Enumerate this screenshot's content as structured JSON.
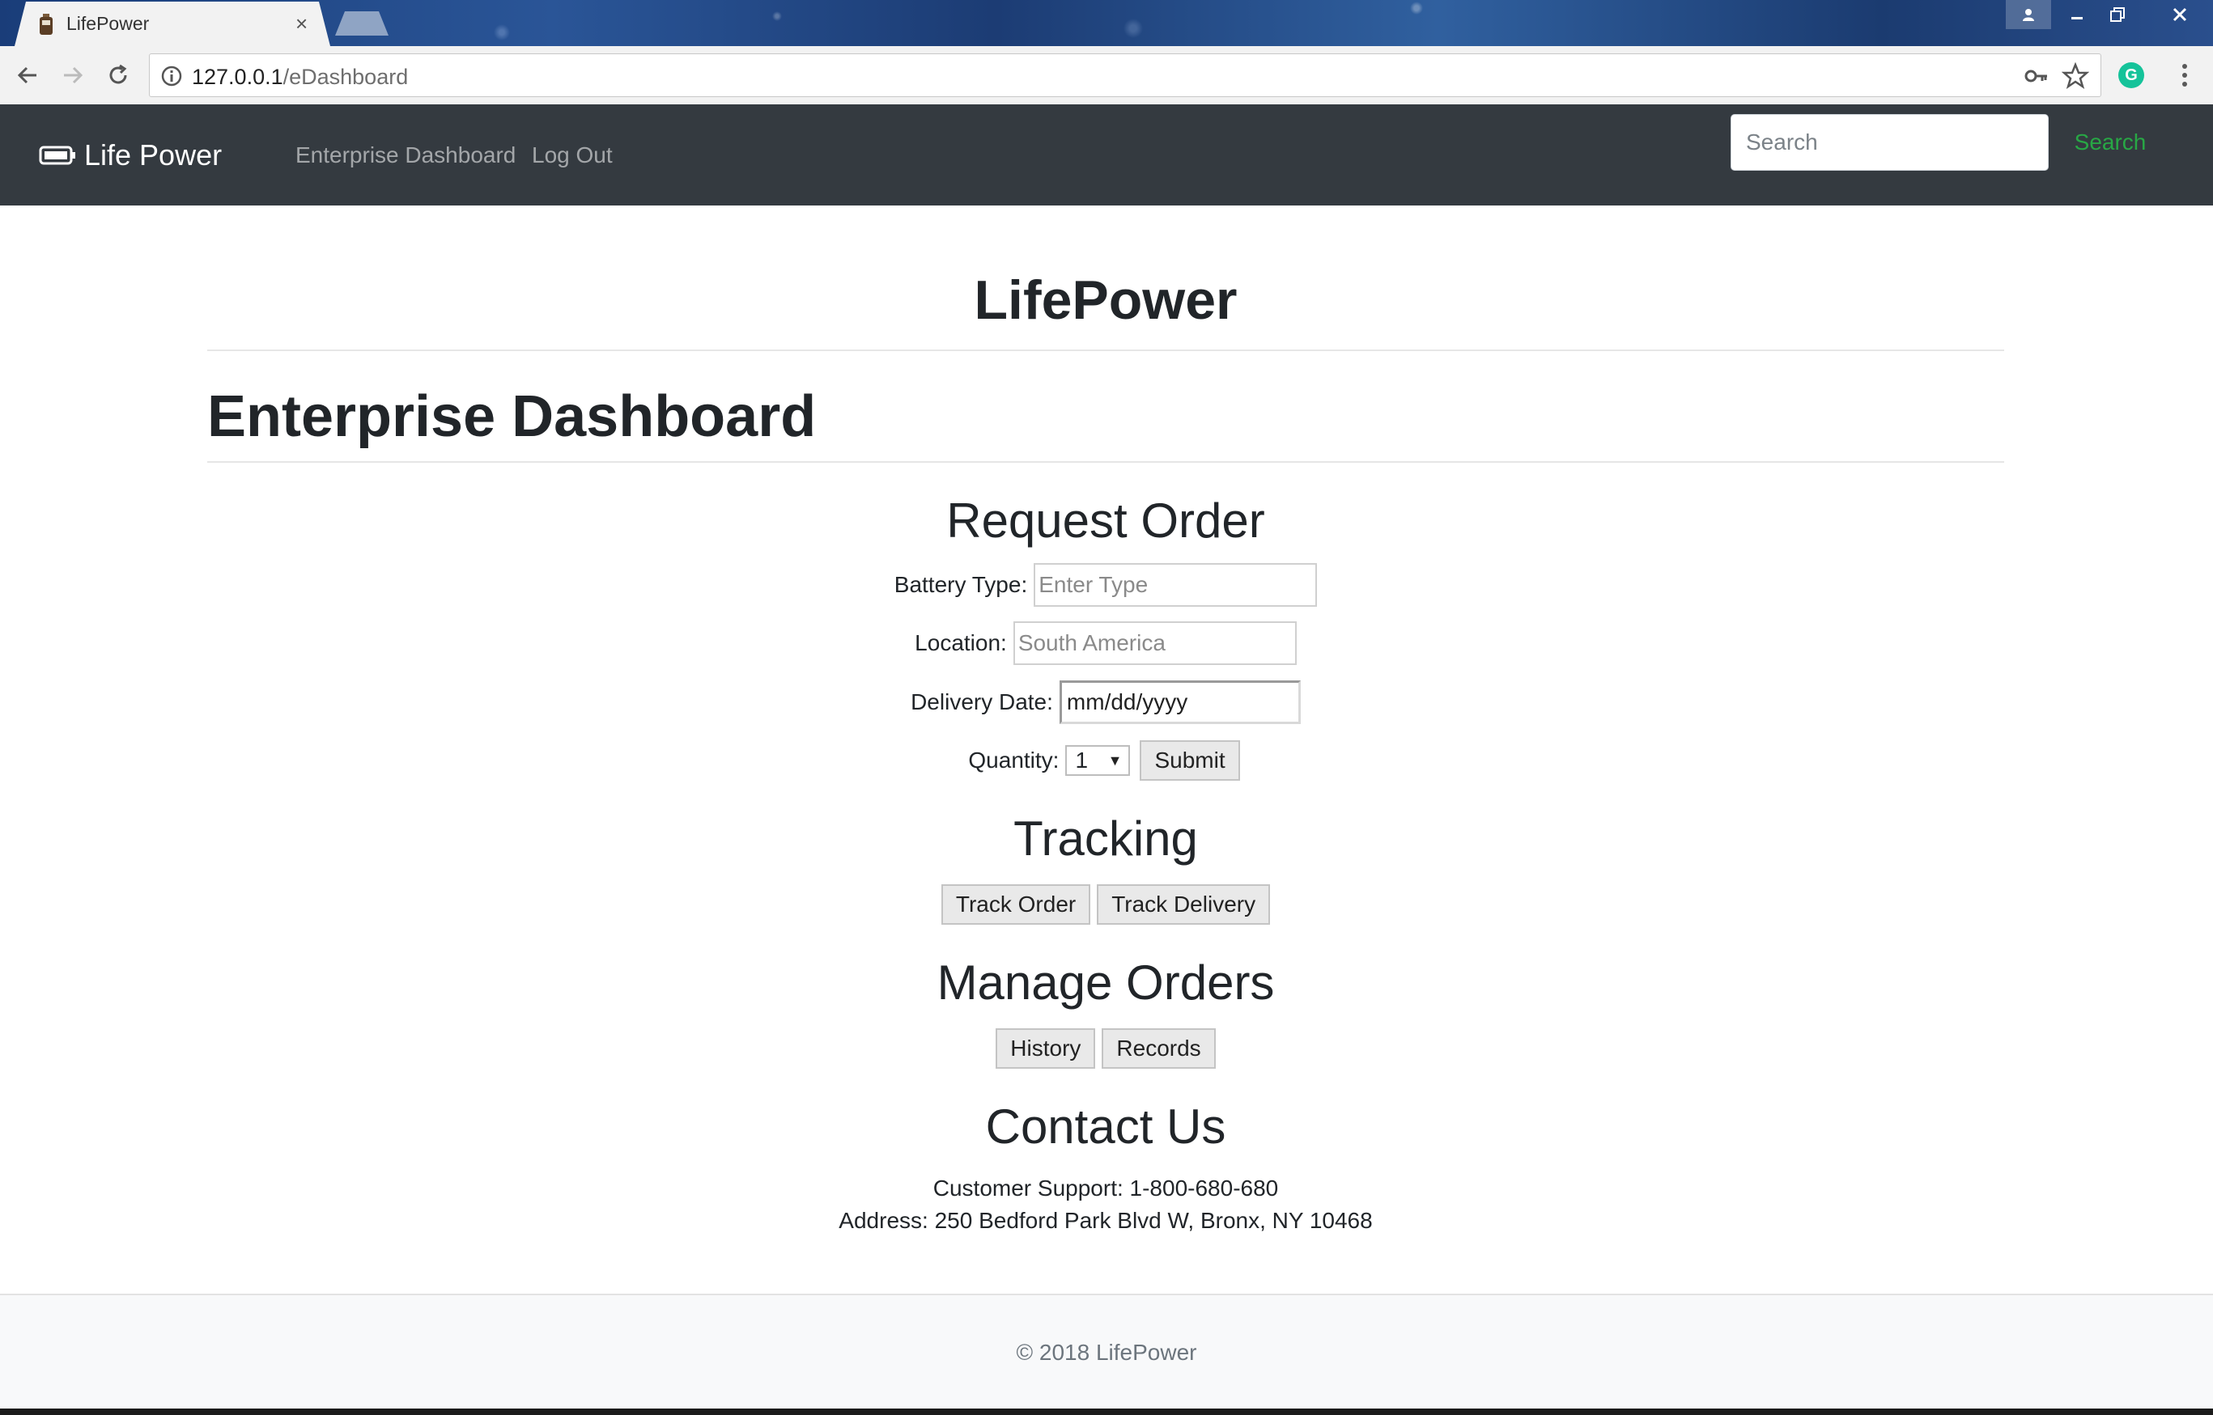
{
  "browser": {
    "tab_title": "LifePower",
    "tab_close": "×",
    "url_host": "127.0.0.1",
    "url_path": "/eDashboard",
    "extension_letter": "G"
  },
  "navbar": {
    "brand": "Life Power",
    "links": [
      "Enterprise Dashboard",
      "Log Out"
    ],
    "search_placeholder": "Search",
    "search_button": "Search",
    "accent_color": "#28a745",
    "background_color": "#343a40"
  },
  "page": {
    "site_title": "LifePower",
    "dashboard_title": "Enterprise Dashboard"
  },
  "request_order": {
    "heading": "Request Order",
    "battery_type_label": "Battery Type:",
    "battery_type_placeholder": "Enter Type",
    "location_label": "Location:",
    "location_placeholder": "South America",
    "delivery_date_label": "Delivery Date:",
    "delivery_date_value": "mm/dd/yyyy",
    "quantity_label": "Quantity:",
    "quantity_value": "1",
    "submit_label": "Submit"
  },
  "tracking": {
    "heading": "Tracking",
    "track_order_label": "Track Order",
    "track_delivery_label": "Track Delivery"
  },
  "manage_orders": {
    "heading": "Manage Orders",
    "history_label": "History",
    "records_label": "Records"
  },
  "contact": {
    "heading": "Contact Us",
    "support": "Customer Support: 1-800-680-680",
    "address": "Address: 250 Bedford Park Blvd W, Bronx, NY 10468"
  },
  "footer": {
    "text": "© 2018 LifePower"
  }
}
